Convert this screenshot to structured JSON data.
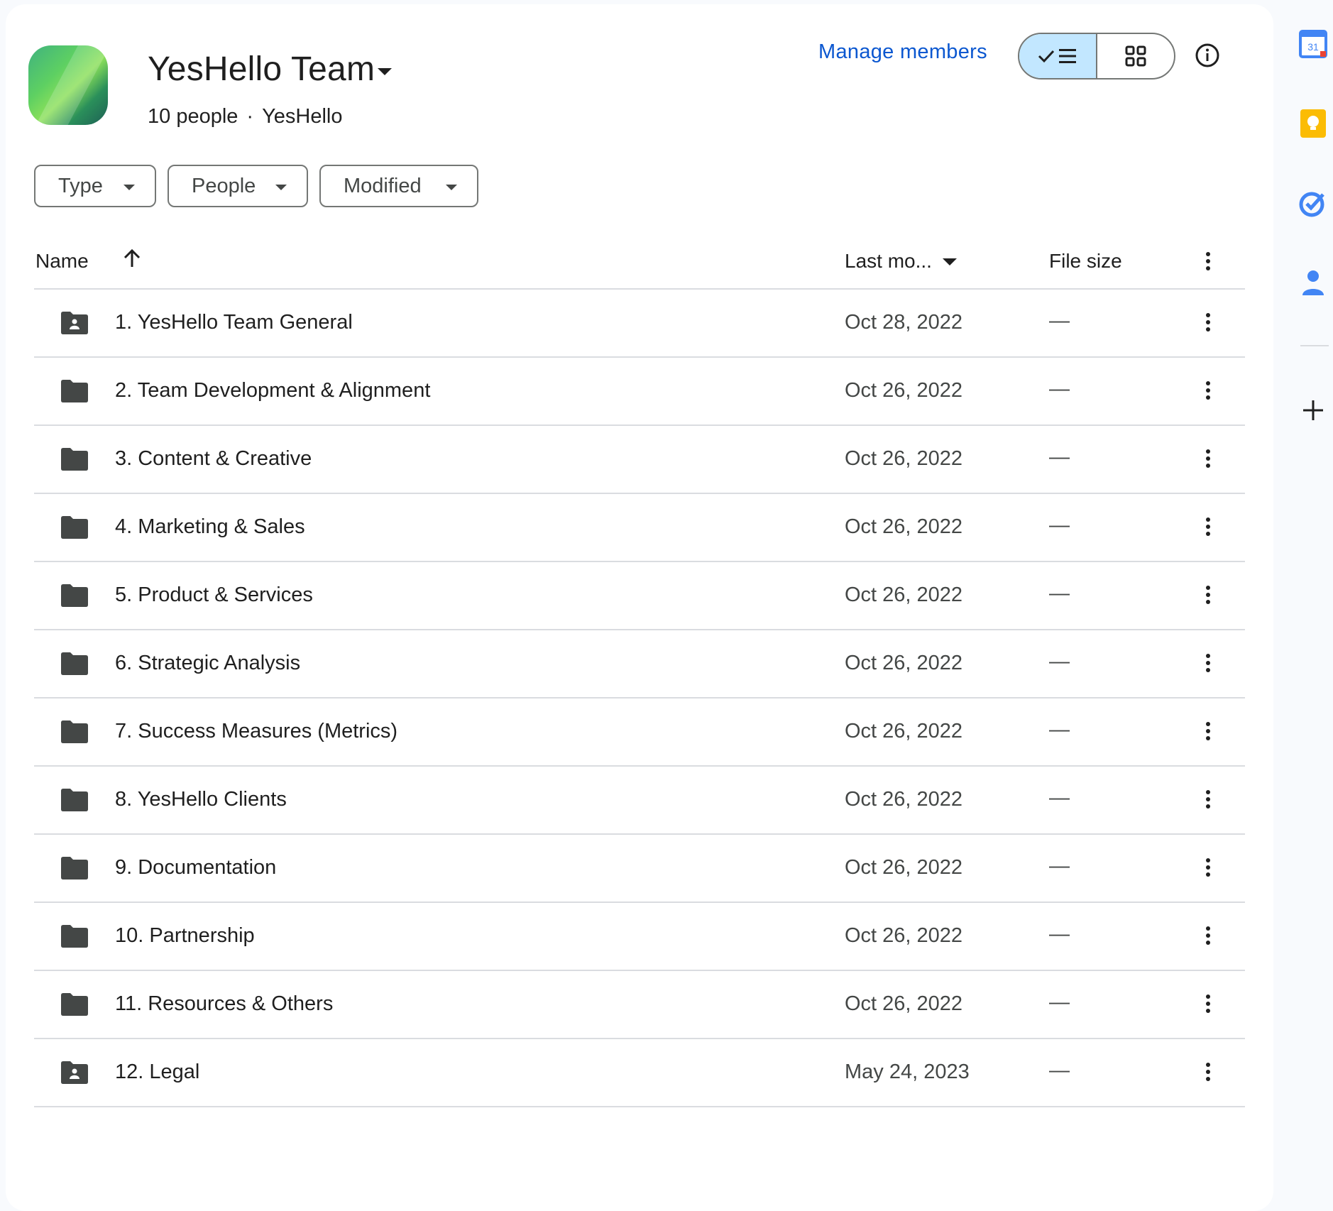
{
  "drive": {
    "title": "YesHello Team",
    "people": "10 people",
    "separator": "·",
    "org": "YesHello"
  },
  "header": {
    "manage_members": "Manage members",
    "view_mode": "list"
  },
  "filters": {
    "type": "Type",
    "people": "People",
    "modified": "Modified"
  },
  "columns": {
    "name": "Name",
    "last_modified": "Last mo...",
    "file_size": "File size"
  },
  "rows": [
    {
      "name": "1. YesHello Team General",
      "date": "Oct 28, 2022",
      "size": "—",
      "icon": "shared-folder-icon"
    },
    {
      "name": "2. Team Development & Alignment",
      "date": "Oct 26, 2022",
      "size": "—",
      "icon": "folder-icon"
    },
    {
      "name": "3. Content & Creative",
      "date": "Oct 26, 2022",
      "size": "—",
      "icon": "folder-icon"
    },
    {
      "name": "4. Marketing & Sales",
      "date": "Oct 26, 2022",
      "size": "—",
      "icon": "folder-icon"
    },
    {
      "name": "5. Product & Services",
      "date": "Oct 26, 2022",
      "size": "—",
      "icon": "folder-icon"
    },
    {
      "name": "6. Strategic Analysis",
      "date": "Oct 26, 2022",
      "size": "—",
      "icon": "folder-icon"
    },
    {
      "name": "7. Success Measures (Metrics)",
      "date": "Oct 26, 2022",
      "size": "—",
      "icon": "folder-icon"
    },
    {
      "name": "8. YesHello Clients",
      "date": "Oct 26, 2022",
      "size": "—",
      "icon": "folder-icon"
    },
    {
      "name": "9. Documentation",
      "date": "Oct 26, 2022",
      "size": "—",
      "icon": "folder-icon"
    },
    {
      "name": "10. Partnership",
      "date": "Oct 26, 2022",
      "size": "—",
      "icon": "folder-icon"
    },
    {
      "name": "11. Resources & Others",
      "date": "Oct 26, 2022",
      "size": "—",
      "icon": "folder-icon"
    },
    {
      "name": "12. Legal",
      "date": "May 24, 2023",
      "size": "—",
      "icon": "shared-folder-icon"
    }
  ],
  "side_panel": {
    "calendar_day": "31",
    "apps": [
      "calendar-icon",
      "keep-icon",
      "tasks-icon",
      "contacts-icon",
      "add-icon"
    ]
  },
  "colors": {
    "accent": "#0b57d0",
    "toggle_active": "#c2e7ff",
    "folder": "#444746"
  }
}
